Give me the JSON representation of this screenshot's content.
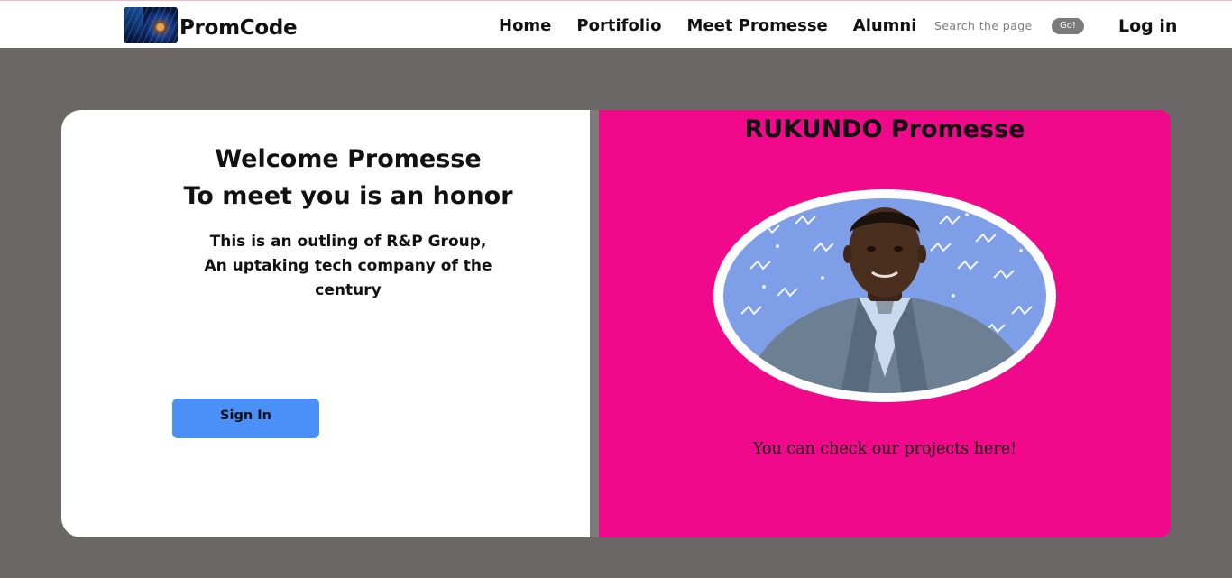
{
  "header": {
    "brand": "PromCode",
    "nav": [
      "Home",
      "Portifolio",
      "Meet Promesse",
      "Alumni"
    ],
    "search_placeholder": "Search the page",
    "search_button": "Go!",
    "login": "Log in"
  },
  "hero": {
    "welcome_line1": "Welcome Promesse",
    "welcome_line2": "To meet you is an honor",
    "subtitle_line1": "This is an outling of R&P Group,",
    "subtitle_line2": "An uptaking tech company of the",
    "subtitle_line3": "century",
    "signin_label": "Sign In"
  },
  "profile": {
    "name": "RUKUNDO Promesse",
    "projects_text": "You can check our projects here!"
  },
  "colors": {
    "page_bg": "#6b6766",
    "profile_bg": "#f0098a",
    "signin_button": "#4a90f7",
    "photo_bg": "#7f9ee8"
  }
}
